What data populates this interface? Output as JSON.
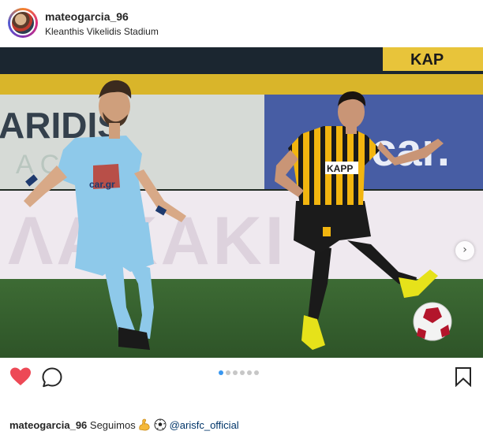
{
  "post": {
    "username": "mateogarcia_96",
    "location": "Kleanthis Vikelidis Stadium"
  },
  "photo": {
    "banner_top": "KAP",
    "banner_left": "ARIDIS",
    "banner_left_sub": "ACETS",
    "banner_right": "car.",
    "banner_low": "ΛΑΚΑΚΙ",
    "shirt_sponsor_left": "car.gr",
    "shirt_sponsor_right": "KAPP"
  },
  "carousel": {
    "slide_count": 6,
    "active_index": 0
  },
  "caption": {
    "username": "mateogarcia_96",
    "text": "Seguimos",
    "emojis": [
      "flexed-biceps",
      "soccer-ball"
    ],
    "mention": "@arisfc_official"
  },
  "colors": {
    "like_red": "#ed4956",
    "dot_active": "#3897f0",
    "aris_yellow": "#f2b50f",
    "opponent_blue": "#8ec9ea"
  }
}
